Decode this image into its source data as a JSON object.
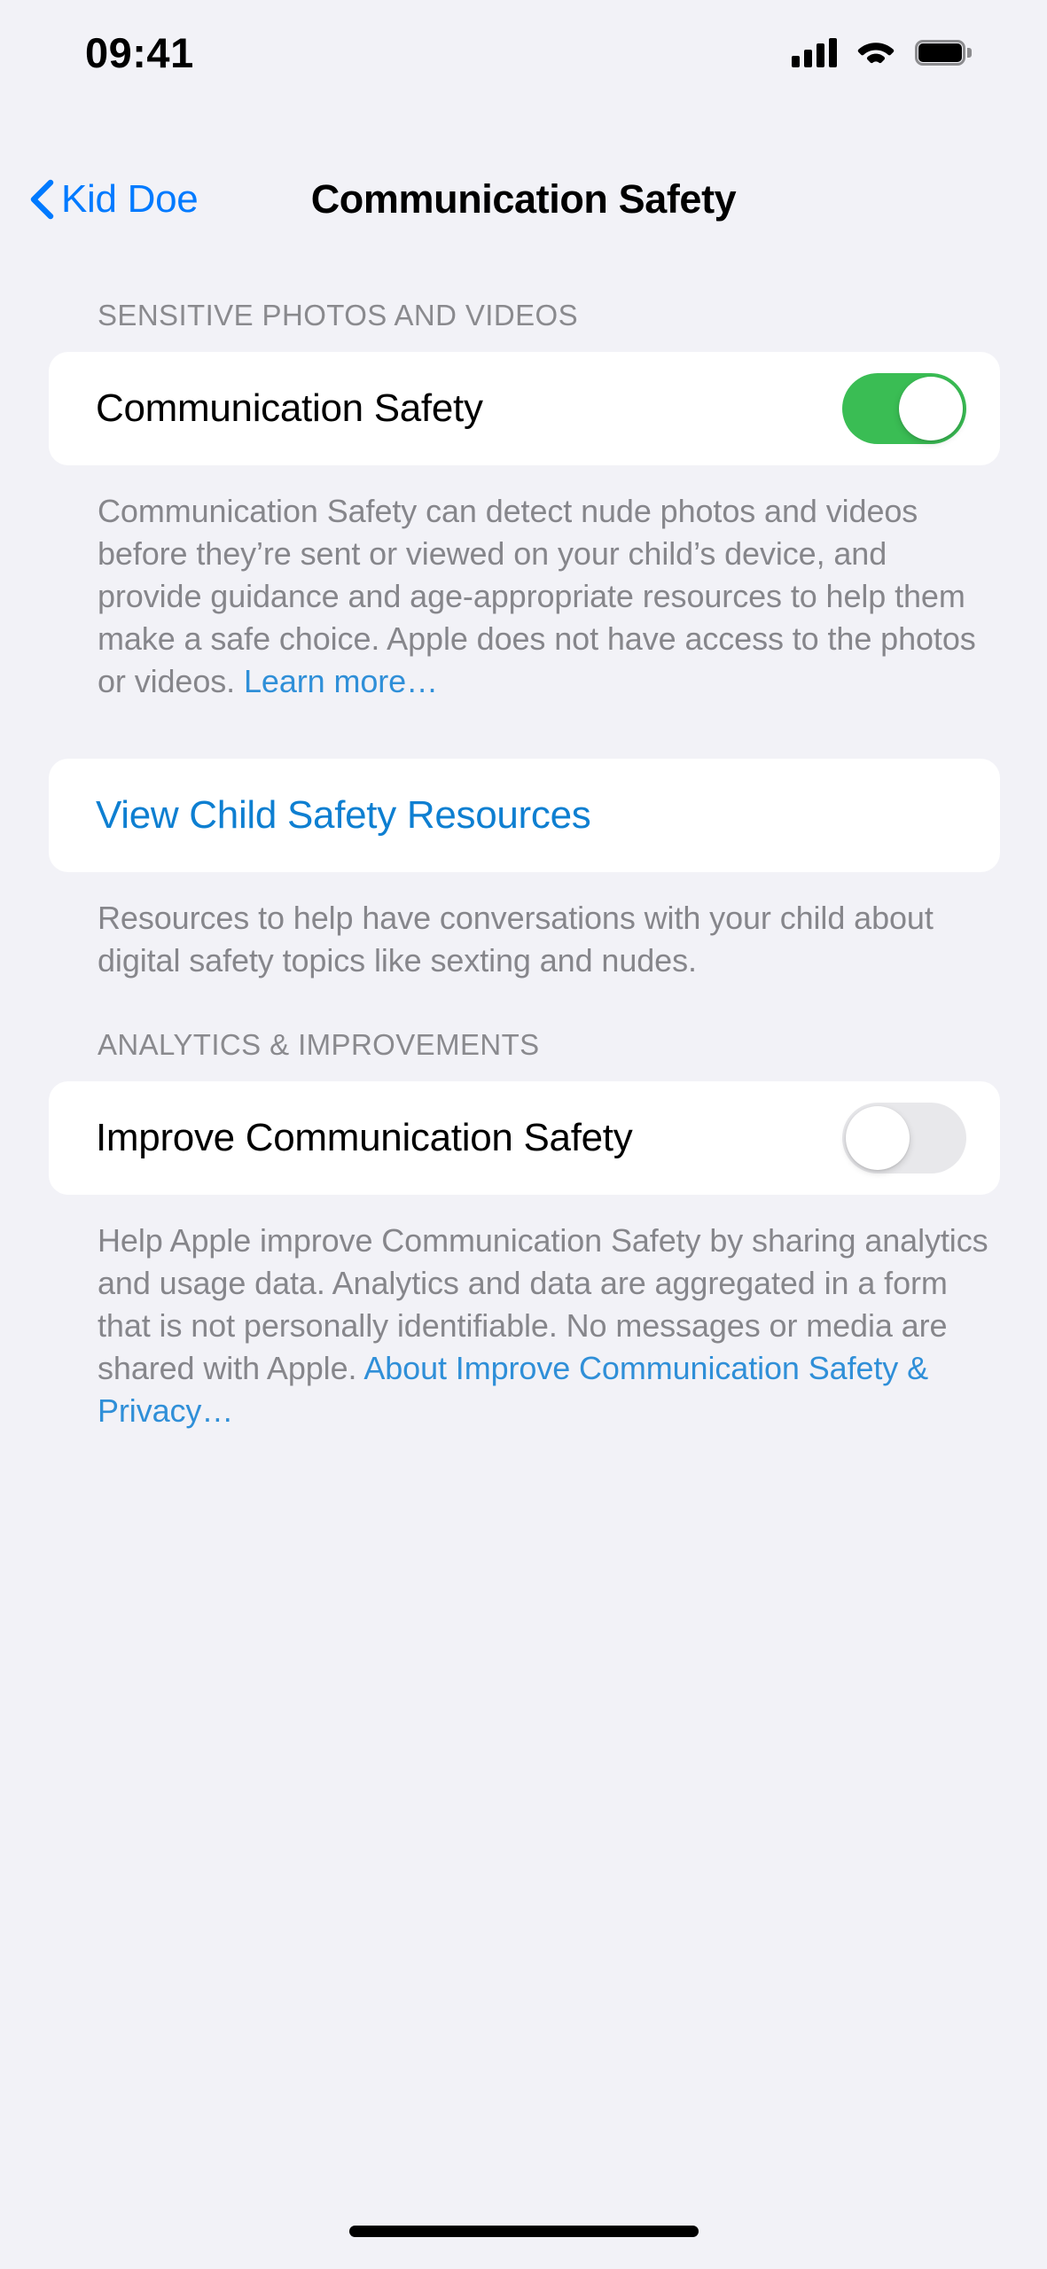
{
  "status_bar": {
    "time": "09:41",
    "cellular_icon": "cellular-signal-icon",
    "wifi_icon": "wifi-icon",
    "battery_icon": "battery-full-icon",
    "battery_level_percent": 100
  },
  "nav": {
    "back_label": "Kid Doe",
    "back_icon": "chevron-left-icon",
    "title": "Communication Safety"
  },
  "sections": [
    {
      "header": "SENSITIVE PHOTOS AND VIDEOS",
      "row_label": "Communication Safety",
      "toggle_state": "on",
      "footnote_before_link": "Communication Safety can detect nude photos and videos before they’re sent or viewed on your child’s device, and provide guidance and age-appropriate resources to help them make a safe choice. Apple does not have access to the photos or videos. ",
      "footnote_link": "Learn more…"
    },
    {
      "row_label": "View Child Safety Resources",
      "footnote": "Resources to help have conversations with your child about digital safety topics like sexting and nudes."
    },
    {
      "header": "ANALYTICS & IMPROVEMENTS",
      "row_label": "Improve Communication Safety",
      "toggle_state": "off",
      "footnote_before_link": "Help Apple improve Communication Safety by sharing analytics and usage data. Analytics and data are aggregated in a form that is not personally identifiable. No messages or media are shared with Apple. ",
      "footnote_link": "About Improve Communication Safety & Privacy…"
    }
  ],
  "home_indicator": "home-indicator",
  "colors": {
    "background": "#F2F2F7",
    "card": "#FFFFFF",
    "accent_blue": "#007AFF",
    "link_blue": "#2F8FD8",
    "toggle_on_green": "#3ABD54",
    "toggle_off_gray": "#E8E8EB",
    "secondary_text": "#86868B",
    "header_text": "#8A8A8E"
  }
}
